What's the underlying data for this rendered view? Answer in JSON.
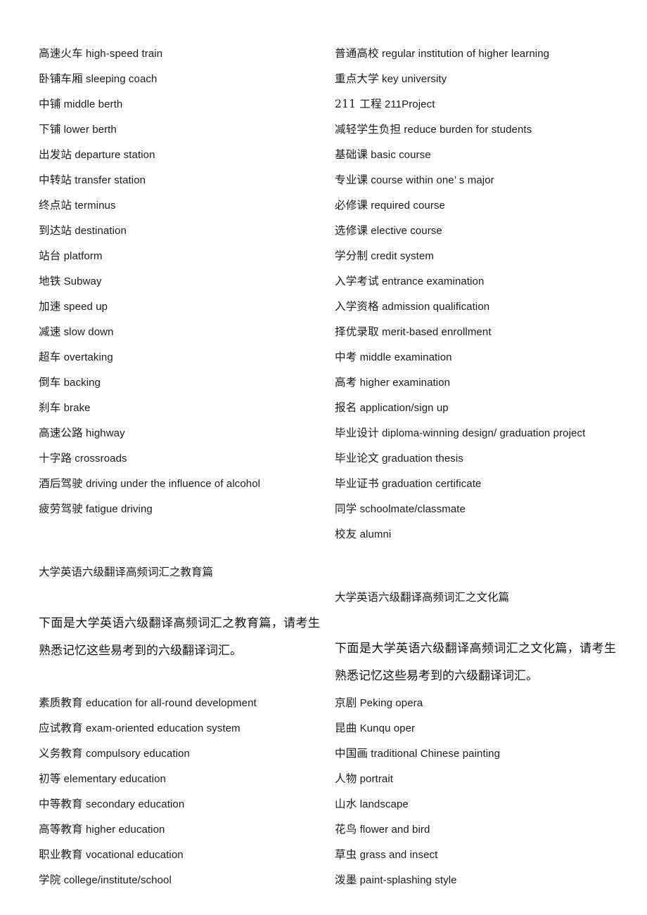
{
  "document": {
    "background_color": "#ffffff",
    "text_color": "#1a1a1a",
    "columns": 2
  },
  "left_column": {
    "transport_vocabulary": [
      {
        "zh": "高速火车",
        "en": "high-speed train"
      },
      {
        "zh": "卧铺车厢",
        "en": "sleeping coach"
      },
      {
        "zh": "中铺",
        "en": "middle berth"
      },
      {
        "zh": "下铺",
        "en": "lower berth"
      },
      {
        "zh": "出发站",
        "en": "departure station"
      },
      {
        "zh": "中转站",
        "en": "transfer station"
      },
      {
        "zh": "终点站",
        "en": "terminus"
      },
      {
        "zh": "到达站",
        "en": "destination"
      },
      {
        "zh": "站台",
        "en": "platform"
      },
      {
        "zh": "地铁",
        "en": "Subway"
      },
      {
        "zh": "加速",
        "en": " speed up"
      },
      {
        "zh": "减速",
        "en": "slow down"
      },
      {
        "zh": "超车",
        "en": "overtaking"
      },
      {
        "zh": "倒车",
        "en": "backing"
      },
      {
        "zh": "刹车",
        "en": "brake"
      },
      {
        "zh": "高速公路",
        "en": "highway"
      },
      {
        "zh": "十字路",
        "en": "crossroads"
      },
      {
        "zh": "酒后驾驶",
        "en": "driving under the influence of alcohol"
      },
      {
        "zh": "疲劳驾驶",
        "en": "fatigue driving"
      }
    ],
    "education_section": {
      "heading": "大学英语六级翻译高频词汇之教育篇",
      "intro": "下面是大学英语六级翻译高频词汇之教育篇，请考生熟悉记忆这些易考到的六级翻译词汇。",
      "vocabulary": [
        {
          "zh": "素质教育",
          "en": "education for all-round development"
        },
        {
          "zh": "应试教育",
          "en": "exam-oriented education system"
        },
        {
          "zh": "义务教育",
          "en": "compulsory education"
        },
        {
          "zh": "初等",
          "en": "elementary education"
        },
        {
          "zh": "中等教育",
          "en": "secondary education"
        },
        {
          "zh": "高等教育",
          "en": "higher education"
        },
        {
          "zh": "职业教育",
          "en": "vocational education"
        },
        {
          "zh": "学院",
          "en": "college/institute/school"
        }
      ]
    }
  },
  "right_column": {
    "education_vocabulary": [
      {
        "zh": "普通高校",
        "en": "regular institution of higher learning"
      },
      {
        "zh": "重点大学",
        "en": "key university"
      },
      {
        "zh": "211 工程",
        "en": "211Project"
      },
      {
        "zh": "减轻学生负担",
        "en": "reduce burden for students"
      },
      {
        "zh": "基础课",
        "en": "basic course"
      },
      {
        "zh": "专业课",
        "en": "course within one’  s major"
      },
      {
        "zh": "必修课",
        "en": "required course"
      },
      {
        "zh": "选修课",
        "en": "elective course"
      },
      {
        "zh": "学分制",
        "en": "credit system"
      },
      {
        "zh": "入学考试",
        "en": "entrance examination"
      },
      {
        "zh": "入学资格",
        "en": "admission qualification"
      },
      {
        "zh": "择优录取",
        "en": " merit-based enrollment"
      },
      {
        "zh": "中考",
        "en": "middle examination"
      },
      {
        "zh": "高考",
        "en": "higher examination"
      },
      {
        "zh": "报名",
        "en": "application/sign up"
      },
      {
        "zh": "毕业设计",
        "en": "diploma-winning design/ graduation project"
      },
      {
        "zh": "毕业论文",
        "en": "graduation thesis"
      },
      {
        "zh": "毕业证书",
        "en": "graduation certificate"
      },
      {
        "zh": "同学",
        "en": "schoolmate/classmate"
      },
      {
        "zh": "校友",
        "en": "alumni"
      }
    ],
    "culture_section": {
      "heading": "大学英语六级翻译高频词汇之文化篇",
      "intro": "下面是大学英语六级翻译高频词汇之文化篇，请考生熟悉记忆这些易考到的六级翻译词汇。",
      "vocabulary": [
        {
          "zh": "京剧",
          "en": "Peking opera"
        },
        {
          "zh": "昆曲",
          "en": "Kunqu oper"
        },
        {
          "zh": "中国画",
          "en": "traditional Chinese painting"
        },
        {
          "zh": "人物",
          "en": "portrait"
        },
        {
          "zh": "山水",
          "en": "landscape"
        },
        {
          "zh": "花鸟",
          "en": "flower and bird"
        },
        {
          "zh": "草虫",
          "en": "grass and insect"
        },
        {
          "zh": "泼墨",
          "en": "paint-splashing style"
        }
      ]
    }
  }
}
